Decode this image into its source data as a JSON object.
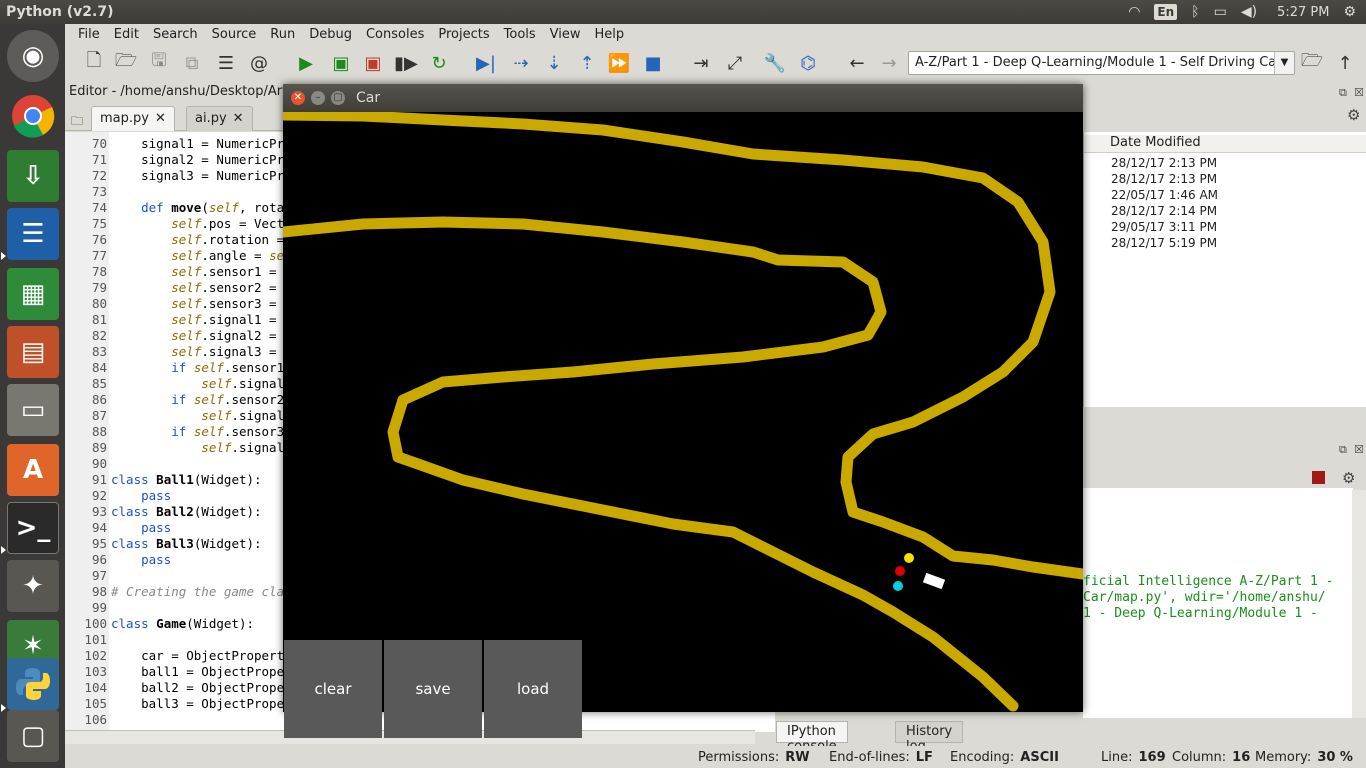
{
  "topbar": {
    "title": "Python (v2.7)",
    "lang": "En",
    "time": "5:27 PM"
  },
  "menu": [
    "File",
    "Edit",
    "Search",
    "Source",
    "Run",
    "Debug",
    "Consoles",
    "Projects",
    "Tools",
    "View",
    "Help"
  ],
  "toolbar": {
    "working_dir": "A-Z/Part 1 - Deep Q-Learning/Module 1 - Self Driving Car"
  },
  "editor": {
    "title": "Editor - /home/anshu/Desktop/Artifi",
    "tabs": [
      {
        "label": "map.py"
      },
      {
        "label": "ai.py"
      }
    ],
    "line_numbers": [
      "70",
      "71",
      "72",
      "73",
      "74",
      "75",
      "76",
      "77",
      "78",
      "79",
      "80",
      "81",
      "82",
      "83",
      "84",
      "85",
      "86",
      "87",
      "88",
      "89",
      "90",
      "91",
      "92",
      "93",
      "94",
      "95",
      "96",
      "97",
      "98",
      "99",
      "100",
      "101",
      "102",
      "103",
      "104",
      "105",
      "106"
    ]
  },
  "files": {
    "header": "Date Modified",
    "rows": [
      "28/12/17 2:13 PM",
      "28/12/17 2:13 PM",
      "22/05/17 1:46 AM",
      "28/12/17 2:14 PM",
      "29/05/17 3:11 PM",
      "28/12/17 5:19 PM"
    ]
  },
  "console": {
    "lines": [
      "ficial Intelligence A-Z/Part 1 -",
      "Car/map.py', wdir='/home/anshu/",
      "1 - Deep Q-Learning/Module 1 -"
    ],
    "tabs": [
      "IPython console",
      "History log"
    ]
  },
  "status": {
    "permissions_label": "Permissions:",
    "permissions": "RW",
    "eol_label": "End-of-lines:",
    "eol": "LF",
    "encoding_label": "Encoding:",
    "encoding": "ASCII",
    "line_label": "Line:",
    "line": "169",
    "column_label": "Column:",
    "column": "16",
    "memory_label": "Memory:",
    "memory": "30 %"
  },
  "car_window": {
    "title": "Car",
    "buttons": {
      "clear": "clear",
      "save": "save",
      "load": "load"
    }
  },
  "colors": {
    "road": "#c9a800",
    "ball_yellow": "#f5e000",
    "ball_red": "#e00000",
    "ball_cyan": "#00d0e0",
    "car": "#ffffff"
  }
}
